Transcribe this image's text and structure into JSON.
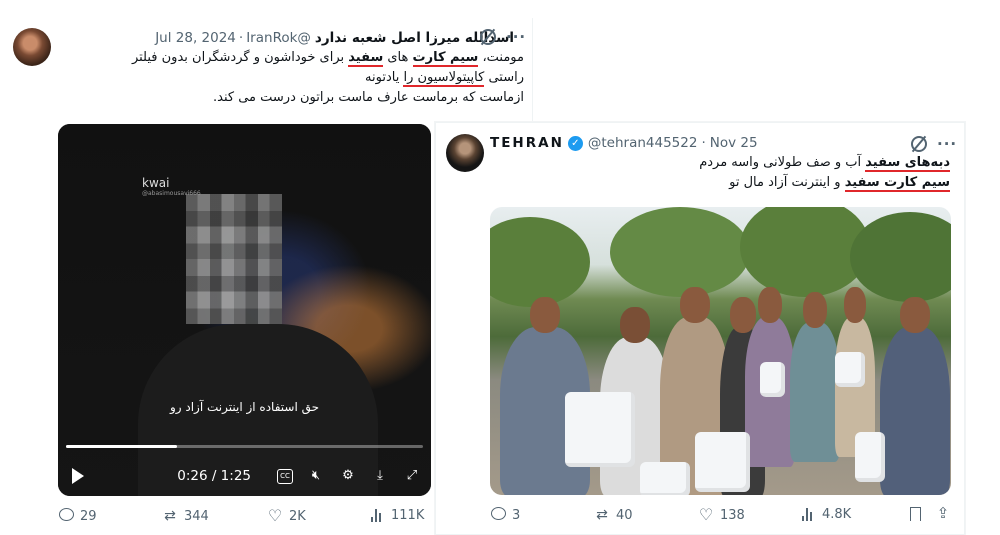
{
  "tweet1": {
    "display_name": "اسدالله میرزا اصل شعبه ندارد",
    "handle": "@IranRok",
    "date": "Jul 28, 2024",
    "lines": [
      {
        "pre": "مومنت، ",
        "hl": "سیم کارت",
        "mid": " های ",
        "hl2": "سفید",
        "post": " برای خوداشون و گردشگران بدون فیلتر"
      },
      {
        "pre": "راستی ",
        "ul": "کاپیتولاسیون را",
        "post": " یادتونه"
      },
      {
        "pre": "ازماست که برماست عارف ماست براتون درست می کند.",
        "ul": "",
        "post": ""
      }
    ],
    "video": {
      "watermark": "kwai",
      "watermark_sub": "@abasimousavi666",
      "subtitle": "حق استفاده از اینترنت آزاد رو",
      "time": "0:26 / 1:25",
      "progress": 0.31
    },
    "stats": {
      "replies": "29",
      "reposts": "344",
      "likes": "2K",
      "views": "111K"
    }
  },
  "tweet2": {
    "display_name": "TEHRAN",
    "handle": "@tehran445522",
    "date": "Nov 25",
    "lines": [
      {
        "pre": "",
        "hl": "دبه‌های سفید",
        "post": " آب و صف طولانی واسه مردم"
      },
      {
        "pre": "",
        "hl": "سیم کارت سفید",
        "post": " و اینترنت آزاد مال تو"
      }
    ],
    "stats": {
      "replies": "3",
      "reposts": "40",
      "likes": "138",
      "views": "4.8K"
    }
  },
  "icons": {
    "more": "more-icon",
    "grok": "grok-icon",
    "reply": "reply-icon",
    "repost": "repost-icon",
    "like": "heart-icon",
    "views": "views-icon",
    "bookmark": "bookmark-icon",
    "share": "share-icon"
  },
  "colors": {
    "accent_underline": "#e0272b",
    "verified": "#1d9bf0",
    "muted": "#536471"
  }
}
